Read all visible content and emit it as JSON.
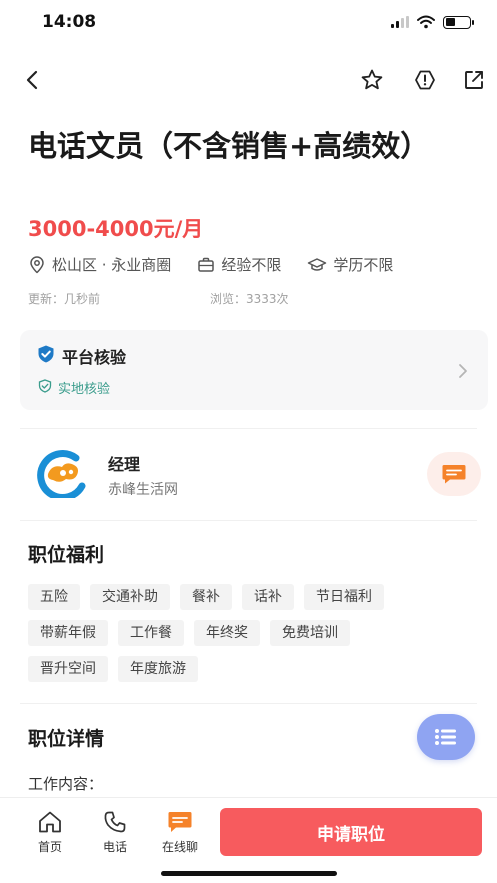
{
  "status_bar": {
    "time": "14:08"
  },
  "job": {
    "title": "电话文员（不含销售+高绩效）",
    "salary": "3000-4000元/月",
    "location": "松山区 · 永业商圈",
    "experience": "经验不限",
    "education": "学历不限",
    "updated": "更新：几秒前",
    "views": "浏览：3333次"
  },
  "verification": {
    "title": "平台核验",
    "badge": "实地核验"
  },
  "company": {
    "role": "经理",
    "name": "赤峰生活网"
  },
  "benefits": {
    "title": "职位福利",
    "tags": [
      "五险",
      "交通补助",
      "餐补",
      "话补",
      "节日福利",
      "带薪年假",
      "工作餐",
      "年终奖",
      "免费培训",
      "晋升空间",
      "年度旅游"
    ]
  },
  "details": {
    "title": "职位详情",
    "work_content_label": "工作内容："
  },
  "bottom_bar": {
    "home": "首页",
    "phone": "电话",
    "chat": "在线聊",
    "apply": "申请职位"
  },
  "colors": {
    "accent_red": "#f04c4c",
    "apply_button": "#f75b5e",
    "chat_orange": "#f5822a",
    "verify_teal": "#3a9c8c",
    "fab_blue": "#8fa4f2"
  }
}
